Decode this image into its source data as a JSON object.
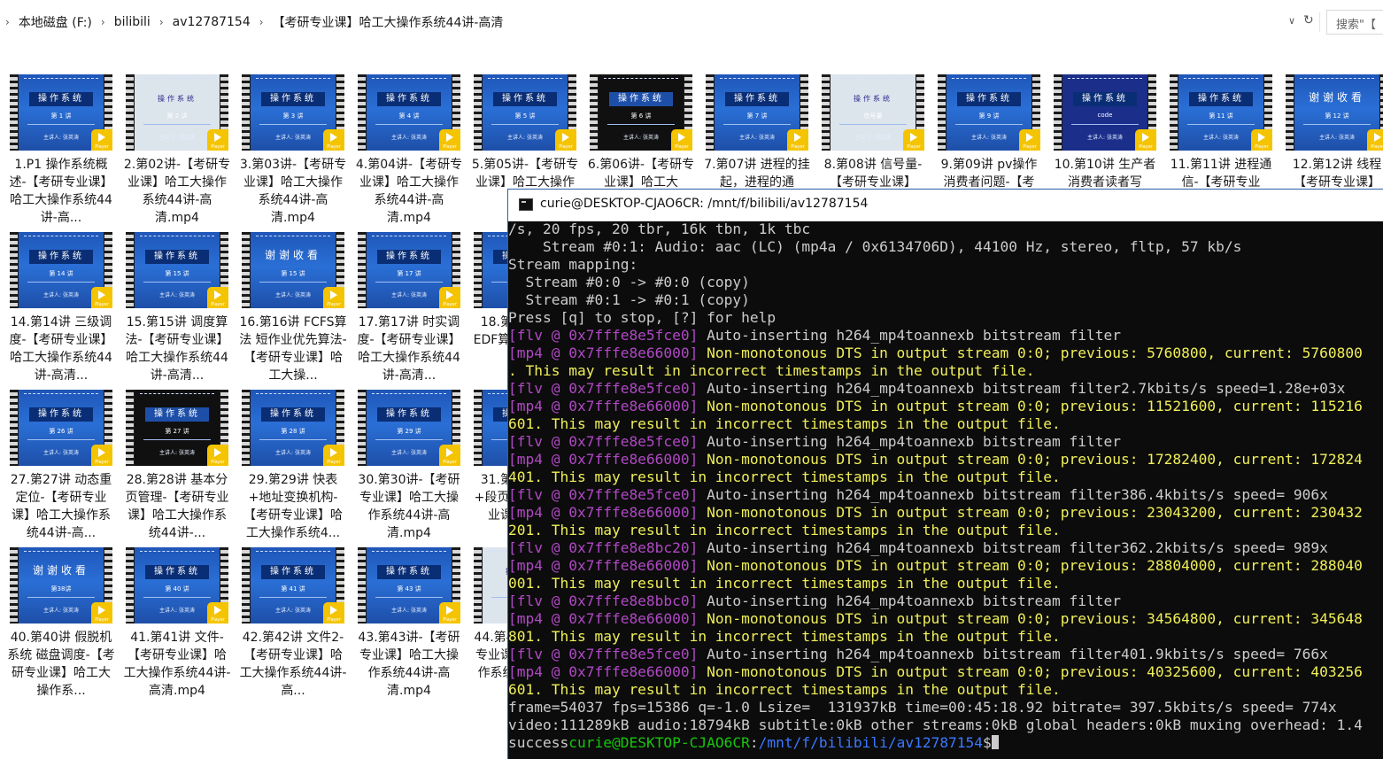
{
  "address_bar": {
    "segments": [
      "本地磁盘 (F:)",
      "bilibili",
      "av12787154",
      "【考研专业课】哈工大操作系统44讲-高清"
    ],
    "search_placeholder": "搜索\"【"
  },
  "files": [
    {
      "label": "1.P1 操作系统概述-【考研专业课】哈工大操作系统44讲-高...",
      "thumb_num": "第 1 讲",
      "style": "title"
    },
    {
      "label": "2.第02讲-【考研专业课】哈工大操作系统44讲-高清.mp4",
      "thumb_num": "第 2 讲",
      "style": "slide"
    },
    {
      "label": "3.第03讲-【考研专业课】哈工大操作系统44讲-高清.mp4",
      "thumb_num": "第 3 讲",
      "style": "title"
    },
    {
      "label": "4.第04讲-【考研专业课】哈工大操作系统44讲-高清.mp4",
      "thumb_num": "第 4 讲",
      "style": "title"
    },
    {
      "label": "5.第05讲-【考研专业课】哈工大操作系",
      "thumb_num": "第 5 讲",
      "style": "title"
    },
    {
      "label": "6.第06讲-【考研专业课】哈工大",
      "thumb_num": "第 6 讲",
      "style": "dark"
    },
    {
      "label": "7.第07讲 进程的挂起，进程的通",
      "thumb_num": "第 7 讲",
      "style": "title"
    },
    {
      "label": "8.第08讲 信号量-【考研专业课】",
      "thumb_num": "信号量",
      "style": "slide"
    },
    {
      "label": "9.第09讲 pv操作消费者问题-【考",
      "thumb_num": "第 9 讲",
      "style": "title"
    },
    {
      "label": "10.第10讲 生产者消费者读者写",
      "thumb_num": "code",
      "style": "code"
    },
    {
      "label": "11.第11讲 进程通信-【考研专业",
      "thumb_num": "第 11 讲",
      "style": "title"
    },
    {
      "label": "12.第12讲 线程【考研专业课】",
      "thumb_num": "第 12 讲",
      "style": "thank"
    },
    {
      "label": "14.第14讲 三级调度-【考研专业课】哈工大操作系统44讲-高清...",
      "thumb_num": "第 14 讲",
      "style": "title"
    },
    {
      "label": "15.第15讲 调度算法-【考研专业课】哈工大操作系统44讲-高清...",
      "thumb_num": "第 15 讲",
      "style": "title"
    },
    {
      "label": "16.第16讲 FCFS算法 短作业优先算法-【考研专业课】哈工大操...",
      "thumb_num": "第 15 讲",
      "style": "thank"
    },
    {
      "label": "17.第17讲 时实调度-【考研专业课】哈工大操作系统44讲-高清...",
      "thumb_num": "第 17 讲",
      "style": "title"
    },
    {
      "label": "18.第18讲 时实 EDF算法-【考研专业",
      "thumb_num": "第 18 讲",
      "style": "title"
    },
    {
      "label": "27.第27讲 动态重定位-【考研专业课】哈工大操作系统44讲-高...",
      "thumb_num": "第 26 讲",
      "style": "title"
    },
    {
      "label": "28.第28讲 基本分页管理-【考研专业课】哈工大操作系统44讲-...",
      "thumb_num": "第 27 讲",
      "style": "dark"
    },
    {
      "label": "29.第29讲 快表+地址变换机构-【考研专业课】哈工大操作系统4...",
      "thumb_num": "第 28 讲",
      "style": "title"
    },
    {
      "label": "30.第30讲-【考研专业课】哈工大操作系统44讲-高清.mp4",
      "thumb_num": "第 29 讲",
      "style": "title"
    },
    {
      "label": "31.第31讲 段式+段页式-【考研专业课】哈工大",
      "thumb_num": "第 31 讲",
      "style": "title"
    },
    {
      "label": "40.第40讲 假脱机系统 磁盘调度-【考研专业课】哈工大操作系...",
      "thumb_num": "第38讲",
      "style": "thank"
    },
    {
      "label": "41.第41讲 文件-【考研专业课】哈工大操作系统44讲-高清.mp4",
      "thumb_num": "第 40 讲",
      "style": "title"
    },
    {
      "label": "42.第42讲 文件2-【考研专业课】哈工大操作系统44讲-高...",
      "thumb_num": "第 41 讲",
      "style": "title"
    },
    {
      "label": "43.第43讲-【考研专业课】哈工大操作系统44讲-高清.mp4",
      "thumb_num": "第 43 讲",
      "style": "title"
    },
    {
      "label": "44.第44讲-【考研专业课】哈工大操作系统44讲-高清",
      "thumb_num": "第 44 讲",
      "style": "slide"
    }
  ],
  "thumb_common": {
    "title": "操作系统",
    "university": "哈尔滨工业大学远程教育课程",
    "author": "主讲人: 张英涛",
    "player_text": "Player",
    "thank_title": "谢谢收看"
  },
  "terminal": {
    "title": "curie@DESKTOP-CJAO6CR: /mnt/f/bilibili/av12787154",
    "lines": [
      [
        {
          "t": "/s, 20 fps, 20 tbr, 16k tbn, 1k tbc",
          "c": "gray"
        }
      ],
      [
        {
          "t": "    Stream #0:1: Audio: aac (LC) (mp4a / 0x6134706D), 44100 Hz, stereo, fltp, 57 kb/s",
          "c": "gray"
        }
      ],
      [
        {
          "t": "Stream mapping:",
          "c": "gray"
        }
      ],
      [
        {
          "t": "  Stream #0:0 -> #0:0 (copy)",
          "c": "gray"
        }
      ],
      [
        {
          "t": "  Stream #0:1 -> #0:1 (copy)",
          "c": "gray"
        }
      ],
      [
        {
          "t": "Press [q] to stop, [?] for help",
          "c": "gray"
        }
      ],
      [
        {
          "t": "[flv @ 0x7fffe8e5fce0]",
          "c": "magenta"
        },
        {
          "t": " Auto-inserting h264_mp4toannexb bitstream filter",
          "c": "gray"
        }
      ],
      [
        {
          "t": "[mp4 @ 0x7fffe8e66000]",
          "c": "magenta"
        },
        {
          "t": " Non-monotonous DTS in output stream 0:0; previous: 5760800, current: 5760800",
          "c": "yellow"
        }
      ],
      [
        {
          "t": ". This may result in incorrect timestamps in the output file.",
          "c": "yellow"
        }
      ],
      [
        {
          "t": "[flv @ 0x7fffe8e5fce0]",
          "c": "magenta"
        },
        {
          "t": " Auto-inserting h264_mp4toannexb bitstream filter2.7kbits/s speed=1.28e+03x",
          "c": "gray"
        }
      ],
      [
        {
          "t": "[mp4 @ 0x7fffe8e66000]",
          "c": "magenta"
        },
        {
          "t": " Non-monotonous DTS in output stream 0:0; previous: 11521600, current: 115216",
          "c": "yellow"
        }
      ],
      [
        {
          "t": "601. This may result in incorrect timestamps in the output file.",
          "c": "yellow"
        }
      ],
      [
        {
          "t": "[flv @ 0x7fffe8e5fce0]",
          "c": "magenta"
        },
        {
          "t": " Auto-inserting h264_mp4toannexb bitstream filter",
          "c": "gray"
        }
      ],
      [
        {
          "t": "[mp4 @ 0x7fffe8e66000]",
          "c": "magenta"
        },
        {
          "t": " Non-monotonous DTS in output stream 0:0; previous: 17282400, current: 172824",
          "c": "yellow"
        }
      ],
      [
        {
          "t": "401. This may result in incorrect timestamps in the output file.",
          "c": "yellow"
        }
      ],
      [
        {
          "t": "[flv @ 0x7fffe8e5fce0]",
          "c": "magenta"
        },
        {
          "t": " Auto-inserting h264_mp4toannexb bitstream filter386.4kbits/s speed= 906x",
          "c": "gray"
        }
      ],
      [
        {
          "t": "[mp4 @ 0x7fffe8e66000]",
          "c": "magenta"
        },
        {
          "t": " Non-monotonous DTS in output stream 0:0; previous: 23043200, current: 230432",
          "c": "yellow"
        }
      ],
      [
        {
          "t": "201. This may result in incorrect timestamps in the output file.",
          "c": "yellow"
        }
      ],
      [
        {
          "t": "[flv @ 0x7fffe8e8bc20]",
          "c": "magenta"
        },
        {
          "t": " Auto-inserting h264_mp4toannexb bitstream filter362.2kbits/s speed= 989x",
          "c": "gray"
        }
      ],
      [
        {
          "t": "[mp4 @ 0x7fffe8e66000]",
          "c": "magenta"
        },
        {
          "t": " Non-monotonous DTS in output stream 0:0; previous: 28804000, current: 288040",
          "c": "yellow"
        }
      ],
      [
        {
          "t": "001. This may result in incorrect timestamps in the output file.",
          "c": "yellow"
        }
      ],
      [
        {
          "t": "[flv @ 0x7fffe8e8bbc0]",
          "c": "magenta"
        },
        {
          "t": " Auto-inserting h264_mp4toannexb bitstream filter",
          "c": "gray"
        }
      ],
      [
        {
          "t": "[mp4 @ 0x7fffe8e66000]",
          "c": "magenta"
        },
        {
          "t": " Non-monotonous DTS in output stream 0:0; previous: 34564800, current: 345648",
          "c": "yellow"
        }
      ],
      [
        {
          "t": "801. This may result in incorrect timestamps in the output file.",
          "c": "yellow"
        }
      ],
      [
        {
          "t": "[flv @ 0x7fffe8e5fce0]",
          "c": "magenta"
        },
        {
          "t": " Auto-inserting h264_mp4toannexb bitstream filter401.9kbits/s speed= 766x",
          "c": "gray"
        }
      ],
      [
        {
          "t": "[mp4 @ 0x7fffe8e66000]",
          "c": "magenta"
        },
        {
          "t": " Non-monotonous DTS in output stream 0:0; previous: 40325600, current: 403256",
          "c": "yellow"
        }
      ],
      [
        {
          "t": "601. This may result in incorrect timestamps in the output file.",
          "c": "yellow"
        }
      ],
      [
        {
          "t": "frame=54037 fps=15386 q=-1.0 Lsize=  131937kB time=00:45:18.92 bitrate= 397.5kbits/s speed= 774x",
          "c": "gray"
        }
      ],
      [
        {
          "t": "video:111289kB audio:18794kB subtitle:0kB other streams:0kB global headers:0kB muxing overhead: 1.4",
          "c": "gray"
        }
      ]
    ],
    "prompt": {
      "prefix": "success",
      "user": "curie@DESKTOP-CJAO6CR",
      "colon": ":",
      "path": "/mnt/f/bilibili/av12787154",
      "symbol": "$"
    }
  },
  "colors": {
    "magenta": "#b148c6",
    "yellow": "#f0ef59",
    "prompt_green": "#16c60c",
    "prompt_blue": "#3b78ff",
    "badge": "#f5c400",
    "slide_blue": "#2a6fd6"
  }
}
